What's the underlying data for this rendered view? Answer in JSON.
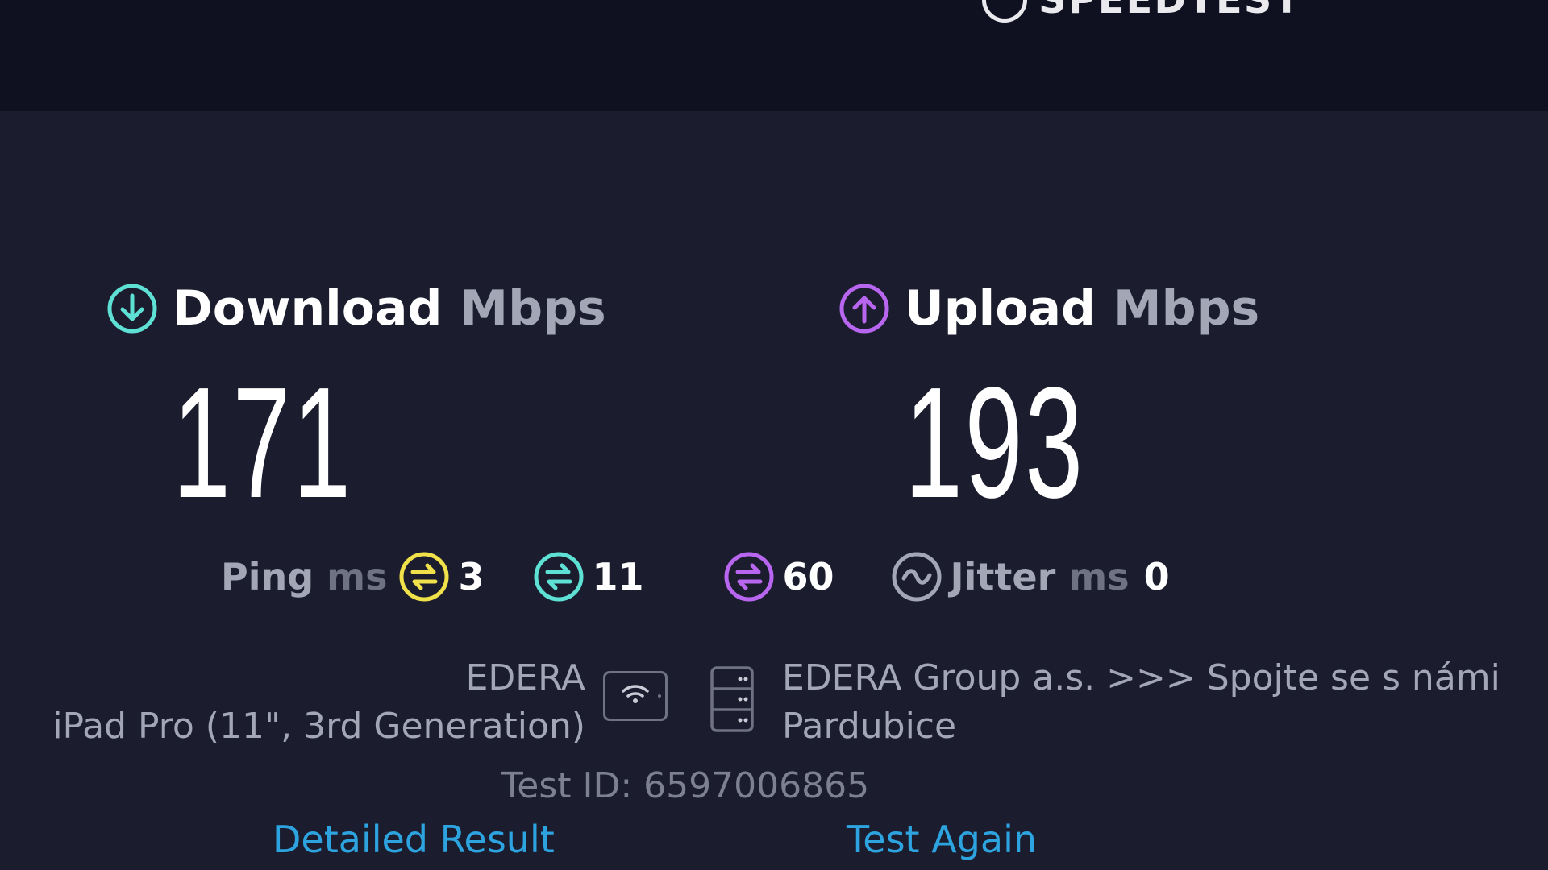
{
  "header": {
    "logo_text": "SPEEDTEST",
    "background": "#0f1020"
  },
  "download": {
    "label": "Download",
    "unit": "Mbps",
    "value": "171",
    "icon": "download-arrow-icon",
    "color": "#5ee0d4"
  },
  "upload": {
    "label": "Upload",
    "unit": "Mbps",
    "value": "193",
    "icon": "upload-arrow-icon",
    "color": "#b866f0"
  },
  "ping": {
    "label": "Ping",
    "unit": "ms",
    "idle": {
      "value": "3",
      "icon": "ping-idle-icon",
      "color": "#f0e04a"
    },
    "download": {
      "value": "11",
      "icon": "ping-download-icon",
      "color": "#5ee0d4"
    },
    "upload": {
      "value": "60",
      "icon": "ping-upload-icon",
      "color": "#b866f0"
    }
  },
  "jitter": {
    "label": "Jitter",
    "unit": "ms",
    "value": "0",
    "icon": "jitter-wave-icon"
  },
  "connection": {
    "provider": "EDERA",
    "device": "iPad Pro (11\", 3rd Generation)",
    "connection_icon": "wifi-icon"
  },
  "server": {
    "name": "EDERA Group a.s. >>> Spojte se s námi",
    "location": "Pardubice",
    "icon": "server-icon"
  },
  "test_id": "Test ID: 6597006865",
  "actions": {
    "detailed": "Detailed Result",
    "again": "Test Again"
  },
  "colors": {
    "background": "#1b1d2e",
    "link": "#2da4e0",
    "muted": "#a3a6b5"
  }
}
